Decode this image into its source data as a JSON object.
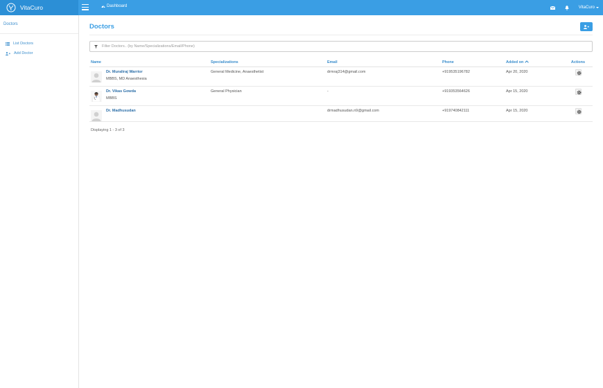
{
  "app": {
    "brand": "VitaCuro"
  },
  "topbar": {
    "nav_label": "Dashboard",
    "user_label": "VitaCuro",
    "icons": [
      "menu-icon",
      "dashboard-icon",
      "mail-icon",
      "bell-icon",
      "caret-down-icon"
    ]
  },
  "sidebar": {
    "title": "Doctors",
    "items": [
      {
        "label": "List Doctors",
        "icon": "list-icon"
      },
      {
        "label": "Add Doctor",
        "icon": "add-user-icon"
      }
    ]
  },
  "page": {
    "title": "Doctors",
    "add_icon": "add-user-icon",
    "filter_placeholder": "Filter Doctors.. (by Name/Specializations/Email/Phone)",
    "filter_icon": "filter-icon"
  },
  "table": {
    "columns": {
      "name": "Name",
      "specializations": "Specializations",
      "email": "Email",
      "phone": "Phone",
      "added_on": "Added on",
      "actions": "Actions"
    },
    "sort_icon": "chevron-up-icon",
    "rows": [
      {
        "name": "Dr. Muraliraj Warrior",
        "qualification": "MBBS, MD Anaesthesia",
        "specializations": "General Medicine, Anaesthetist",
        "email": "drmraj314@gmail.com",
        "phone": "+919535196782",
        "added_on": "Apr 20, 2020",
        "avatar": "placeholder"
      },
      {
        "name": "Dr. Vikas Gowda",
        "qualification": "MBBS",
        "specializations": "General Physician",
        "email": "-",
        "phone": "+919353564626",
        "added_on": "Apr 15, 2020",
        "avatar": "photo"
      },
      {
        "name": "Dr. Madhusudan",
        "qualification": "",
        "specializations": "",
        "email": "drmadhusudan.n9@gmail.com",
        "phone": "+919740842111",
        "added_on": "Apr 15, 2020",
        "avatar": "placeholder"
      }
    ]
  },
  "footer": {
    "count_text": "Displaying 1 - 3 of 3"
  },
  "colors": {
    "topbar": "#3a9ee4",
    "brand_bg": "#2c8fd6",
    "link": "#3a8dcc",
    "name_link": "#2d6fa8"
  }
}
